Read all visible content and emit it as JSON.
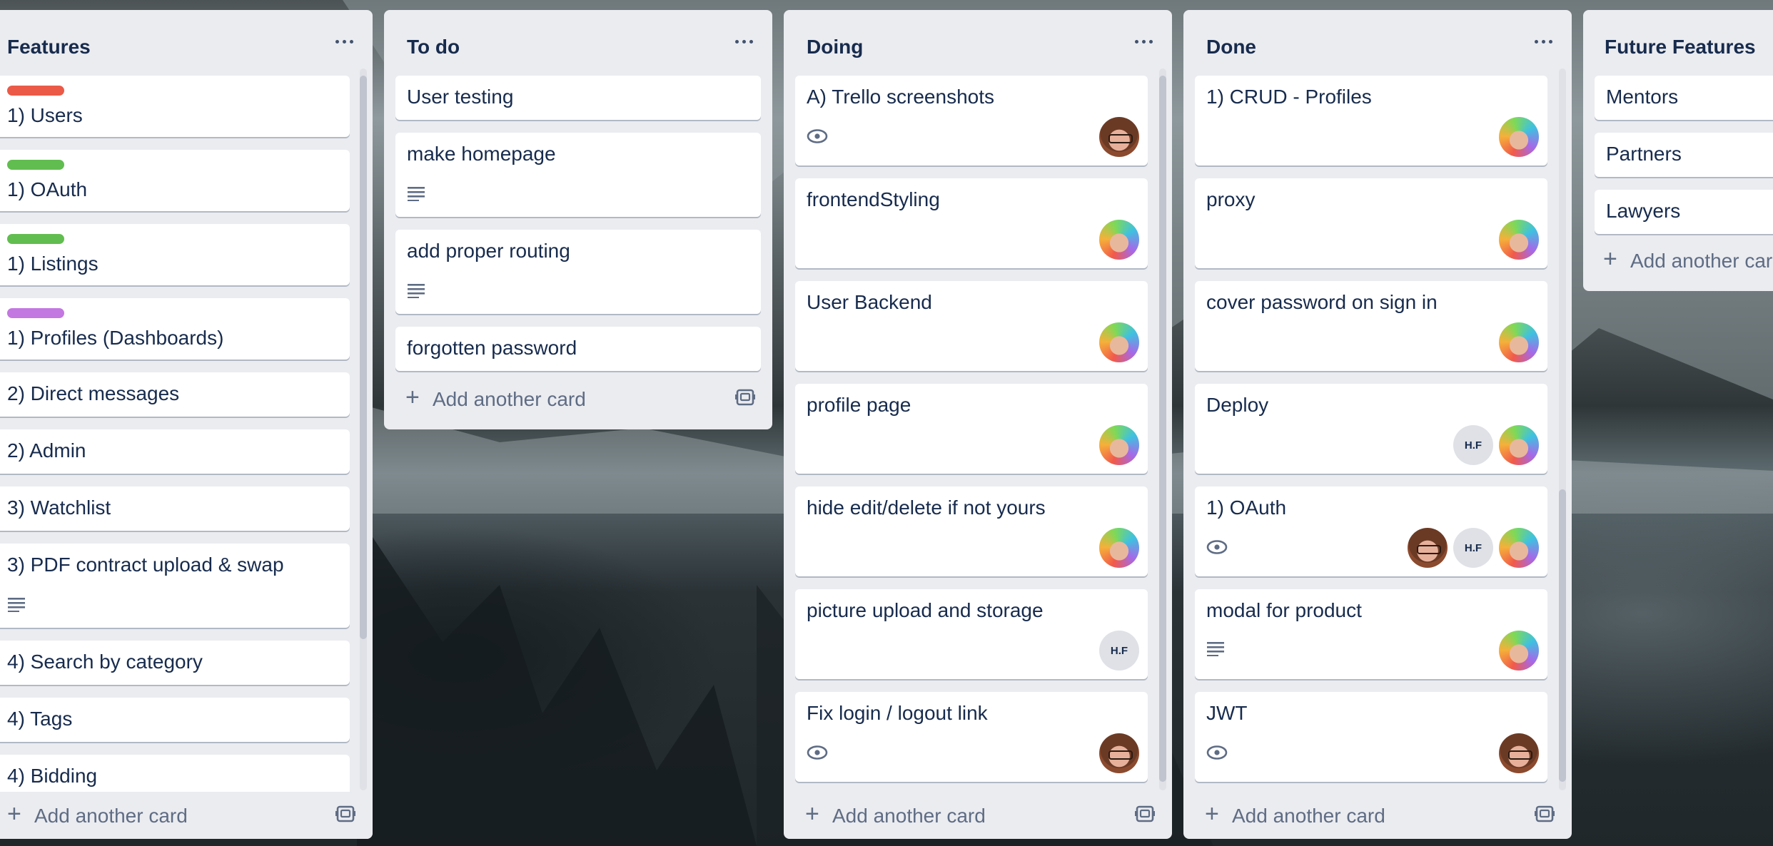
{
  "colors": {
    "label_red": "#eb5a46",
    "label_green": "#61bd4f",
    "label_purple": "#c377e0",
    "list_bg": "#ebecf0",
    "card_text": "#172b4d",
    "muted": "#5e6c84"
  },
  "add_card_label": "Add another card",
  "lists": [
    {
      "title": "Features",
      "cards": [
        {
          "text": "1) Users",
          "label": "label_red"
        },
        {
          "text": "1) OAuth",
          "label": "label_green"
        },
        {
          "text": "1) Listings",
          "label": "label_green"
        },
        {
          "text": "1) Profiles (Dashboards)",
          "label": "label_purple"
        },
        {
          "text": "2) Direct messages"
        },
        {
          "text": "2) Admin"
        },
        {
          "text": "3) Watchlist"
        },
        {
          "text": "3) PDF contract upload & swap",
          "badge": "description-icon"
        },
        {
          "text": "4) Search by category"
        },
        {
          "text": "4) Tags"
        },
        {
          "text": "4) Bidding"
        }
      ]
    },
    {
      "title": "To do",
      "cards": [
        {
          "text": "User testing"
        },
        {
          "text": "make homepage",
          "badge": "description-icon"
        },
        {
          "text": "add proper routing",
          "badge": "description-icon"
        },
        {
          "text": "forgotten password"
        }
      ]
    },
    {
      "title": "Doing",
      "cards": [
        {
          "text": "A) Trello screenshots",
          "badge": "watch-icon",
          "members": [
            "glasses"
          ]
        },
        {
          "text": "frontendStyling",
          "members": [
            "rainbow"
          ]
        },
        {
          "text": "User Backend",
          "members": [
            "rainbow"
          ]
        },
        {
          "text": "profile page",
          "members": [
            "rainbow"
          ]
        },
        {
          "text": "hide edit/delete if not yours",
          "members": [
            "rainbow"
          ]
        },
        {
          "text": "picture upload and storage",
          "members": [
            "H.F"
          ]
        },
        {
          "text": "Fix login / logout link",
          "badge": "watch-icon",
          "members": [
            "glasses"
          ]
        }
      ]
    },
    {
      "title": "Done",
      "cards": [
        {
          "text": "1) CRUD - Profiles",
          "members": [
            "rainbow"
          ]
        },
        {
          "text": "proxy",
          "members": [
            "rainbow"
          ]
        },
        {
          "text": "cover password on sign in",
          "members": [
            "rainbow"
          ]
        },
        {
          "text": "Deploy",
          "members": [
            "H.F",
            "rainbow"
          ]
        },
        {
          "text": "1) OAuth",
          "badge": "watch-icon",
          "members": [
            "glasses",
            "H.F",
            "rainbow"
          ]
        },
        {
          "text": "modal for product",
          "badge": "description-icon",
          "members": [
            "rainbow"
          ]
        },
        {
          "text": "JWT",
          "badge": "watch-icon",
          "members": [
            "glasses"
          ]
        }
      ]
    },
    {
      "title": "Future Features",
      "cards": [
        {
          "text": "Mentors"
        },
        {
          "text": "Partners"
        },
        {
          "text": "Lawyers"
        }
      ]
    }
  ]
}
